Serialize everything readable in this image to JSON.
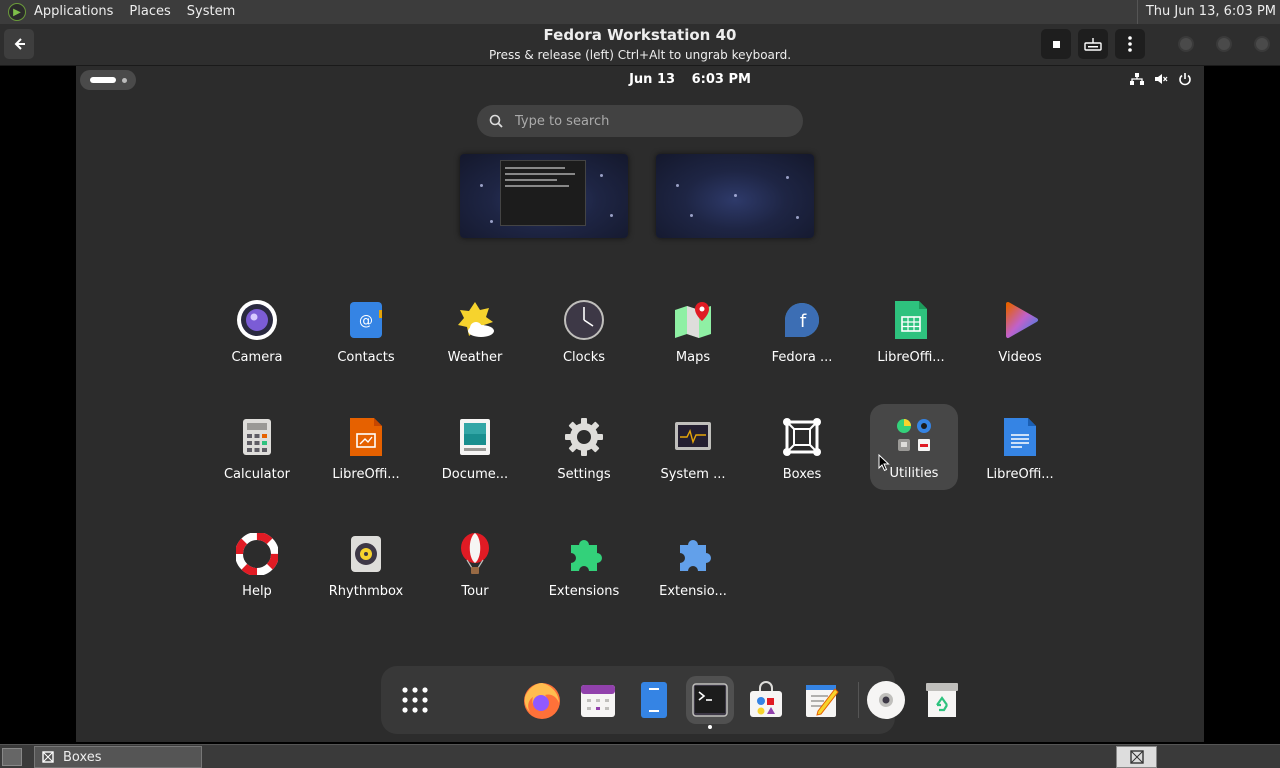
{
  "host_panel": {
    "menus": [
      "Applications",
      "Places",
      "System"
    ],
    "clock": "Thu Jun 13,  6:03 PM"
  },
  "boxes_header": {
    "title": "Fedora Workstation 40",
    "subtitle": "Press & release (left) Ctrl+Alt to ungrab keyboard."
  },
  "guest_topbar": {
    "date": "Jun 13",
    "time": "6:03 PM"
  },
  "search": {
    "placeholder": "Type to search"
  },
  "apps": [
    {
      "label": "Camera",
      "icon": "camera-icon"
    },
    {
      "label": "Contacts",
      "icon": "contacts-icon"
    },
    {
      "label": "Weather",
      "icon": "weather-icon"
    },
    {
      "label": "Clocks",
      "icon": "clocks-icon"
    },
    {
      "label": "Maps",
      "icon": "maps-icon"
    },
    {
      "label": "Fedora ...",
      "icon": "fedora-media-writer-icon"
    },
    {
      "label": "LibreOffi...",
      "icon": "libreoffice-calc-icon"
    },
    {
      "label": "Videos",
      "icon": "videos-icon"
    },
    {
      "label": "Calculator",
      "icon": "calculator-icon"
    },
    {
      "label": "LibreOffi...",
      "icon": "libreoffice-impress-icon"
    },
    {
      "label": "Docume...",
      "icon": "document-viewer-icon"
    },
    {
      "label": "Settings",
      "icon": "settings-icon"
    },
    {
      "label": "System ...",
      "icon": "system-monitor-icon"
    },
    {
      "label": "Boxes",
      "icon": "boxes-icon"
    },
    {
      "label": "Utilities",
      "icon": "utilities-folder-icon"
    },
    {
      "label": "LibreOffi...",
      "icon": "libreoffice-writer-icon"
    },
    {
      "label": "Help",
      "icon": "help-icon"
    },
    {
      "label": "Rhythmbox",
      "icon": "rhythmbox-icon"
    },
    {
      "label": "Tour",
      "icon": "tour-icon"
    },
    {
      "label": "Extensions",
      "icon": "extensions-icon"
    },
    {
      "label": "Extensio...",
      "icon": "extension-manager-icon"
    }
  ],
  "dock": [
    "app-grid-icon",
    "firefox-icon",
    "calendar-icon",
    "files-icon",
    "terminal-icon",
    "software-icon",
    "text-editor-icon",
    "disc-icon",
    "trash-icon"
  ],
  "host_taskbar": {
    "task_label": "Boxes"
  },
  "colors": {
    "guest_bg": "#2c2c2c",
    "dock_bg": "#383838",
    "accent_blue": "#3584e4"
  }
}
